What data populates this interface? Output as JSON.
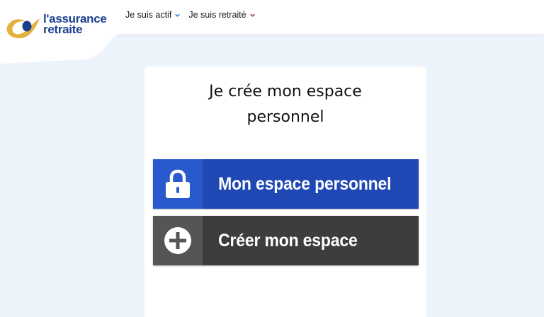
{
  "header": {
    "logo": {
      "line1": "l'assurance",
      "line2": "retraite",
      "colors": {
        "blue": "#1b3f8f",
        "gold": "#e3b23c"
      }
    },
    "nav": [
      {
        "label": "Je suis actif",
        "icon": "chevron-down-icon"
      },
      {
        "label": "Je suis retraité",
        "icon": "chevron-down-icon"
      }
    ]
  },
  "card": {
    "title_line1": "Je crée mon espace",
    "title_line2": "personnel",
    "buttons": [
      {
        "label": "Mon espace personnel",
        "icon": "lock-icon",
        "color": "#1f48b5"
      },
      {
        "label": "Créer mon espace",
        "icon": "plus-circle-icon",
        "color": "#3d3d3d"
      }
    ]
  },
  "colors": {
    "background": "#edf3fb",
    "nav_chevron_actif": "#1f6fc5",
    "nav_chevron_retraite": "#8a2d5a"
  }
}
